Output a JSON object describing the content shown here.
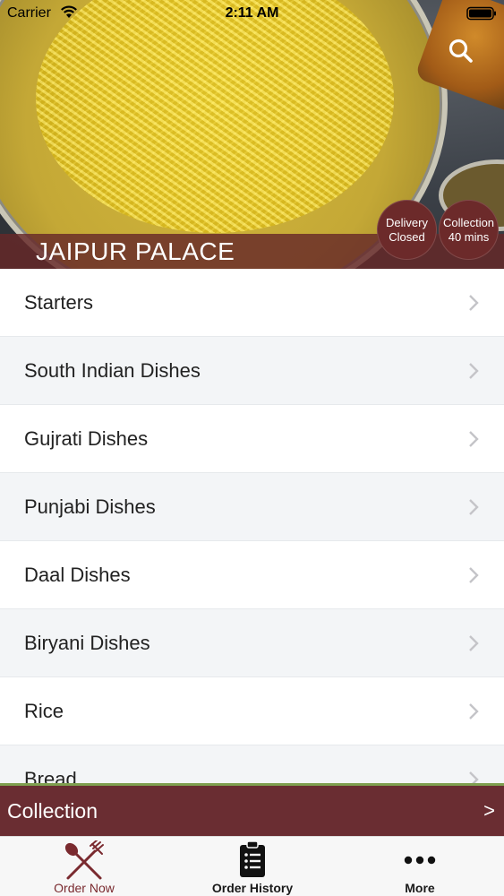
{
  "status_bar": {
    "carrier": "Carrier",
    "time": "2:11 AM",
    "wifi_icon": "wifi-icon",
    "battery_icon": "battery-icon"
  },
  "header": {
    "restaurant_name": "JAIPUR PALACE",
    "search_icon": "search-icon",
    "delivery_badge": {
      "line1": "Delivery",
      "line2": "Closed"
    },
    "collection_badge": {
      "line1": "Collection",
      "line2": "40 mins"
    }
  },
  "menu": {
    "categories": [
      {
        "label": "Starters"
      },
      {
        "label": "South Indian Dishes"
      },
      {
        "label": "Gujrati Dishes"
      },
      {
        "label": "Punjabi Dishes"
      },
      {
        "label": "Daal Dishes"
      },
      {
        "label": "Biryani Dishes"
      },
      {
        "label": "Rice"
      },
      {
        "label": "Bread"
      }
    ],
    "chevron_icon": "chevron-right-icon"
  },
  "order_type_bar": {
    "label": "Collection",
    "arrow": ">"
  },
  "tab_bar": {
    "tabs": [
      {
        "label": "Order Now",
        "icon": "fork-spoon-icon",
        "active": true
      },
      {
        "label": "Order History",
        "icon": "clipboard-list-icon",
        "active": false
      },
      {
        "label": "More",
        "icon": "more-dots-icon",
        "active": false
      }
    ]
  },
  "colors": {
    "brand_maroon": "#6a2d32",
    "active_tab": "#7a2a2f",
    "accent_green": "#7fa050"
  }
}
